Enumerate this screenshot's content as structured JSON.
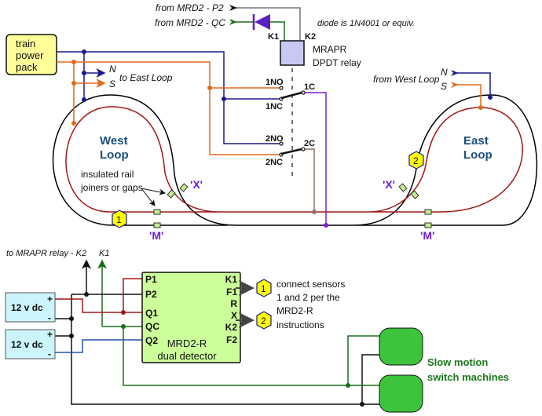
{
  "power_pack": {
    "label_lines": [
      "train",
      "power",
      "pack"
    ]
  },
  "top_inputs": {
    "p2": "from MRD2 - P2",
    "qc": "from MRD2 - QC",
    "diode_note": "diode is 1N4001 or equiv."
  },
  "relay": {
    "k1": "K1",
    "k2": "K2",
    "name": "MRAPR",
    "type": "DPDT relay",
    "contacts": {
      "no1": "1NO",
      "nc1": "1NC",
      "c1": "1C",
      "no2": "2NO",
      "nc2": "2NC",
      "c2": "2C"
    }
  },
  "west_outputs": {
    "n": "N",
    "s": "S",
    "label": "to East Loop"
  },
  "east_inputs": {
    "n": "N",
    "s": "S",
    "label": "from West Loop"
  },
  "loops": {
    "west": [
      "West",
      "Loop"
    ],
    "east": [
      "East",
      "Loop"
    ]
  },
  "gaps_note": [
    "insulated rail",
    "joiners or gaps"
  ],
  "markers": {
    "x": "'X'",
    "m": "'M'",
    "sensor1": "1",
    "sensor2": "2"
  },
  "bottom": {
    "relay_label": "to MRAPR relay - K2",
    "k1_label": "K1",
    "supplies": [
      {
        "label": "12 v dc",
        "plus": "+",
        "minus": "-"
      },
      {
        "label": "12 v dc",
        "plus": "+",
        "minus": "-"
      }
    ],
    "detector": {
      "name": "MRD2-R",
      "subtitle": "dual detector",
      "left_pins": [
        "P1",
        "P2",
        "Q1",
        "QC",
        "Q2"
      ],
      "right_pins": [
        "K1",
        "F1",
        "R",
        "X",
        "K2",
        "F2"
      ]
    },
    "instructions": [
      "connect sensors",
      "1 and 2 per the",
      "MRD2-R",
      "instructions"
    ],
    "machines_label": [
      "Slow motion",
      "switch machines"
    ]
  },
  "colors": {
    "north": "#1a1a8c",
    "south": "#e06a1a",
    "rail_inner": "#a01818",
    "rail_outer": "#000000",
    "k1_green": "#1a6e1a",
    "purple": "#7a1fd6",
    "brown": "#8a7560",
    "relay_fill": "#c8c8f5",
    "detector_fill": "#ccff99",
    "supply_fill": "#ccf4fb",
    "machine_fill": "#3cc43c",
    "sensor_fill": "#ffff00"
  }
}
